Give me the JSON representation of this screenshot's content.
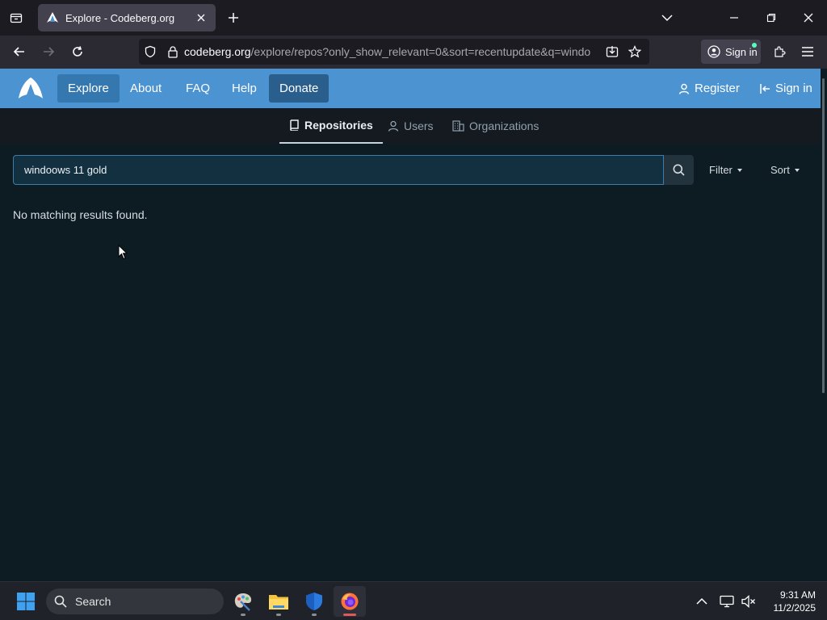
{
  "browser": {
    "tab_title": "Explore - Codeberg.org",
    "url_host": "codeberg.org",
    "url_path": "/explore/repos?only_show_relevant=0&sort=recentupdate&q=windo",
    "signin_label": "Sign in"
  },
  "site_nav": {
    "explore": "Explore",
    "about": "About",
    "faq": "FAQ",
    "help": "Help",
    "donate": "Donate",
    "register": "Register",
    "signin": "Sign in"
  },
  "subnav": {
    "repositories": "Repositories",
    "users": "Users",
    "organizations": "Organizations"
  },
  "search": {
    "value": "windoows 11 gold",
    "filter_label": "Filter",
    "sort_label": "Sort"
  },
  "results": {
    "empty_message": "No matching results found."
  },
  "taskbar": {
    "search_label": "Search",
    "time": "9:31 AM",
    "date": "11/2/2025"
  },
  "colors": {
    "header_blue": "#4b93d1",
    "page_bg": "#0d1b22",
    "input_border": "#3c7ea9"
  }
}
